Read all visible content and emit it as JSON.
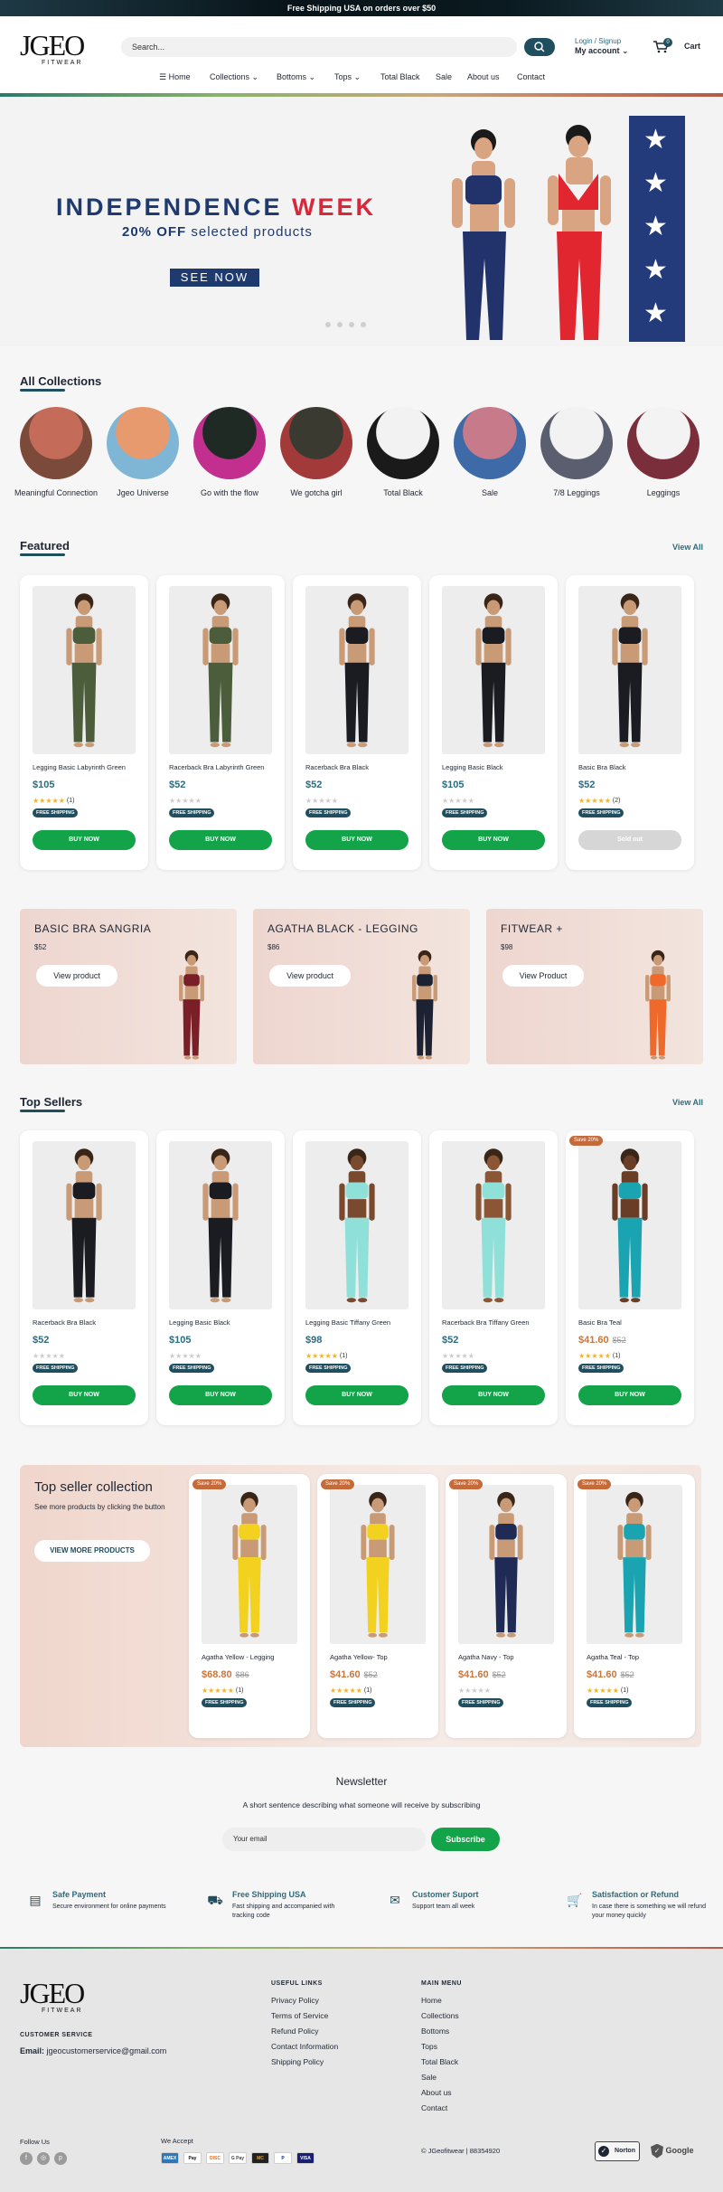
{
  "announcement": "Free Shipping USA on orders over $50",
  "brand": {
    "name": "JGEO",
    "sub": "FITWEAR"
  },
  "search": {
    "placeholder": "Search..."
  },
  "account": {
    "login": "Login / Signup",
    "label": "My account"
  },
  "cart": {
    "label": "Cart",
    "count": "0"
  },
  "nav": [
    "Home",
    "Collections",
    "Bottoms",
    "Tops",
    "Total Black",
    "Sale",
    "About us",
    "Contact"
  ],
  "hero": {
    "title_a": "INDEPENDENCE ",
    "title_b": "WEEK",
    "sub_a": "20% OFF",
    "sub_b": " selected products",
    "cta": "SEE NOW"
  },
  "collections": {
    "title": "All Collections",
    "items": [
      {
        "label": "Meaningful Connection",
        "colors": [
          "#c46b5a",
          "#7b4a3a"
        ]
      },
      {
        "label": "Jgeo Universe",
        "colors": [
          "#e69a6e",
          "#7fb6d6"
        ]
      },
      {
        "label": "Go with the flow",
        "colors": [
          "#1f2a25",
          "#c22f8e"
        ]
      },
      {
        "label": "We gotcha girl",
        "colors": [
          "#3a3a30",
          "#a33a3a"
        ]
      },
      {
        "label": "Total Black",
        "colors": [
          "#f2f2f2",
          "#1a1a1a"
        ]
      },
      {
        "label": "Sale",
        "colors": [
          "#c77a8a",
          "#3f6aa8"
        ]
      },
      {
        "label": "7/8 Leggings",
        "colors": [
          "#f2f2f2",
          "#5a5e6e"
        ]
      },
      {
        "label": "Leggings",
        "colors": [
          "#f3f3f3",
          "#7a2e3b"
        ]
      }
    ]
  },
  "featured": {
    "title": "Featured",
    "view_all": "View All",
    "products": [
      {
        "name": "Legging Basic Labyrinth Green",
        "price": "$105",
        "old": "",
        "rating": 5,
        "reviews": "(1)",
        "badge": "FREE SHIPPING",
        "button": "BUY NOW",
        "sold": false,
        "top": "#4c5d3b",
        "bottom": "#4c5d3b",
        "skin": "#c99a76"
      },
      {
        "name": "Racerback Bra Labyrinth Green",
        "price": "$52",
        "old": "",
        "rating": 0,
        "reviews": "",
        "badge": "FREE SHIPPING",
        "button": "BUY NOW",
        "sold": false,
        "top": "#4c5d3b",
        "bottom": "#4c5d3b",
        "skin": "#c99a76"
      },
      {
        "name": "Racerback Bra Black",
        "price": "$52",
        "old": "",
        "rating": 0,
        "reviews": "",
        "badge": "FREE SHIPPING",
        "button": "BUY NOW",
        "sold": false,
        "top": "#1b1b22",
        "bottom": "#1b1b22",
        "skin": "#c99a76"
      },
      {
        "name": "Legging Basic Black",
        "price": "$105",
        "old": "",
        "rating": 0,
        "reviews": "",
        "badge": "FREE SHIPPING",
        "button": "BUY NOW",
        "sold": false,
        "top": "#1b1b22",
        "bottom": "#1b1b22",
        "skin": "#c99a76"
      },
      {
        "name": "Basic Bra Black",
        "price": "$52",
        "old": "",
        "rating": 5,
        "reviews": "(2)",
        "badge": "FREE SHIPPING",
        "button": "Sold out",
        "sold": true,
        "top": "#1b1b22",
        "bottom": "#1b1b22",
        "skin": "#c99a76"
      }
    ]
  },
  "promos": [
    {
      "title": "BASIC BRA SANGRIA",
      "price": "$52",
      "button": "View product",
      "color": "#7a1f27"
    },
    {
      "title": "AGATHA BLACK - LEGGING",
      "price": "$86",
      "button": "View product",
      "color": "#1d2233"
    },
    {
      "title": "FITWEAR +",
      "price": "$98",
      "button": "View Product",
      "color": "#ef6a2a"
    }
  ],
  "top_sellers": {
    "title": "Top Sellers",
    "view_all": "View All",
    "products": [
      {
        "name": "Racerback Bra Black",
        "price": "$52",
        "old": "",
        "save": "",
        "rating": 0,
        "reviews": "",
        "badge": "FREE SHIPPING",
        "button": "BUY NOW",
        "top": "#1b1b22",
        "bottom": "#1b1b22",
        "skin": "#c99a76"
      },
      {
        "name": "Legging Basic Black",
        "price": "$105",
        "old": "",
        "save": "",
        "rating": 0,
        "reviews": "",
        "badge": "FREE SHIPPING",
        "button": "BUY NOW",
        "top": "#1b1b22",
        "bottom": "#1b1b22",
        "skin": "#c99a76"
      },
      {
        "name": "Legging Basic Tiffany Green",
        "price": "$98",
        "old": "",
        "save": "",
        "rating": 5,
        "reviews": "(1)",
        "badge": "FREE SHIPPING",
        "button": "BUY NOW",
        "top": "#8fe0d8",
        "bottom": "#8fe0d8",
        "skin": "#7a4a2e"
      },
      {
        "name": "Racerback Bra Tiffany Green",
        "price": "$52",
        "old": "",
        "save": "",
        "rating": 0,
        "reviews": "",
        "badge": "FREE SHIPPING",
        "button": "BUY NOW",
        "top": "#8fe0d8",
        "bottom": "#8fe0d8",
        "skin": "#8a5636"
      },
      {
        "name": "Basic Bra Teal",
        "price": "$41.60",
        "old": "$52",
        "save": "Save 20%",
        "rating": 5,
        "reviews": "(1)",
        "badge": "FREE SHIPPING",
        "button": "BUY NOW",
        "top": "#1aa3b0",
        "bottom": "#1aa3b0",
        "skin": "#6a3e26"
      }
    ]
  },
  "top_collection": {
    "title": "Top seller collection",
    "desc": "See more products by clicking the button",
    "button": "VIEW MORE PRODUCTS",
    "products": [
      {
        "name": "Agatha Yellow - Legging",
        "price": "$68.80",
        "old": "$86",
        "save": "Save 20%",
        "rating": 5,
        "reviews": "(1)",
        "badge": "FREE SHIPPING",
        "top": "#f2d21e",
        "bottom": "#f2d21e",
        "skin": "#c99a76"
      },
      {
        "name": "Agatha Yellow- Top",
        "price": "$41.60",
        "old": "$52",
        "save": "Save 20%",
        "rating": 5,
        "reviews": "(1)",
        "badge": "FREE SHIPPING",
        "top": "#f2d21e",
        "bottom": "#f2d21e",
        "skin": "#c99a76"
      },
      {
        "name": "Agatha Navy - Top",
        "price": "$41.60",
        "old": "$52",
        "save": "Save 20%",
        "rating": 0,
        "reviews": "",
        "badge": "FREE SHIPPING",
        "top": "#1f2a55",
        "bottom": "#1f2a55",
        "skin": "#c99a76"
      },
      {
        "name": "Agatha Teal - Top",
        "price": "$41.60",
        "old": "$52",
        "save": "Save 20%",
        "rating": 5,
        "reviews": "(1)",
        "badge": "FREE SHIPPING",
        "top": "#1aa3b0",
        "bottom": "#1aa3b0",
        "skin": "#c99a76"
      }
    ]
  },
  "newsletter": {
    "title": "Newsletter",
    "desc": "A short sentence describing what someone will receive by subscribing",
    "placeholder": "Your email",
    "button": "Subscribe"
  },
  "features": [
    {
      "title": "Safe Payment",
      "desc": "Secure environment for online payments",
      "icon": "payment-icon",
      "glyph": "▤"
    },
    {
      "title": "Free Shipping USA",
      "desc": "Fast shipping and accompanied with tracking code",
      "icon": "truck-icon",
      "glyph": "⛟"
    },
    {
      "title": "Customer Suport",
      "desc": "Support team all week",
      "icon": "mail-icon",
      "glyph": "✉"
    },
    {
      "title": "Satisfaction or Refund",
      "desc": "In case there is something we will refund your money quickly",
      "icon": "cart-refund-icon",
      "glyph": "🛒"
    }
  ],
  "footer": {
    "customer_service": "CUSTOMER SERVICE",
    "email_label": "Email:",
    "email": " jgeocustomerservice@gmail.com",
    "useful_title": "USEFUL LINKS",
    "useful": [
      "Privacy Policy",
      "Terms of Service",
      "Refund Policy",
      "Contact Information",
      "Shipping Policy"
    ],
    "menu_title": "MAIN MENU",
    "menu": [
      "Home",
      "Collections",
      "Bottoms",
      "Tops",
      "Total Black",
      "Sale",
      "About us",
      "Contact"
    ],
    "follow": "Follow Us",
    "we_accept": "We Accept",
    "payments": [
      "AMEX",
      "Pay",
      "DISC",
      "G Pay",
      "MC",
      "P",
      "VISA"
    ],
    "copyright": "© JGeofitwear | 88354920",
    "norton": "Norton",
    "google": "Google"
  },
  "colors": {
    "accent": "#1f4e5f",
    "buy": "#13a44a",
    "sale": "#c8763f",
    "hero_navy": "#1f3a6e",
    "hero_red": "#d8273a"
  }
}
